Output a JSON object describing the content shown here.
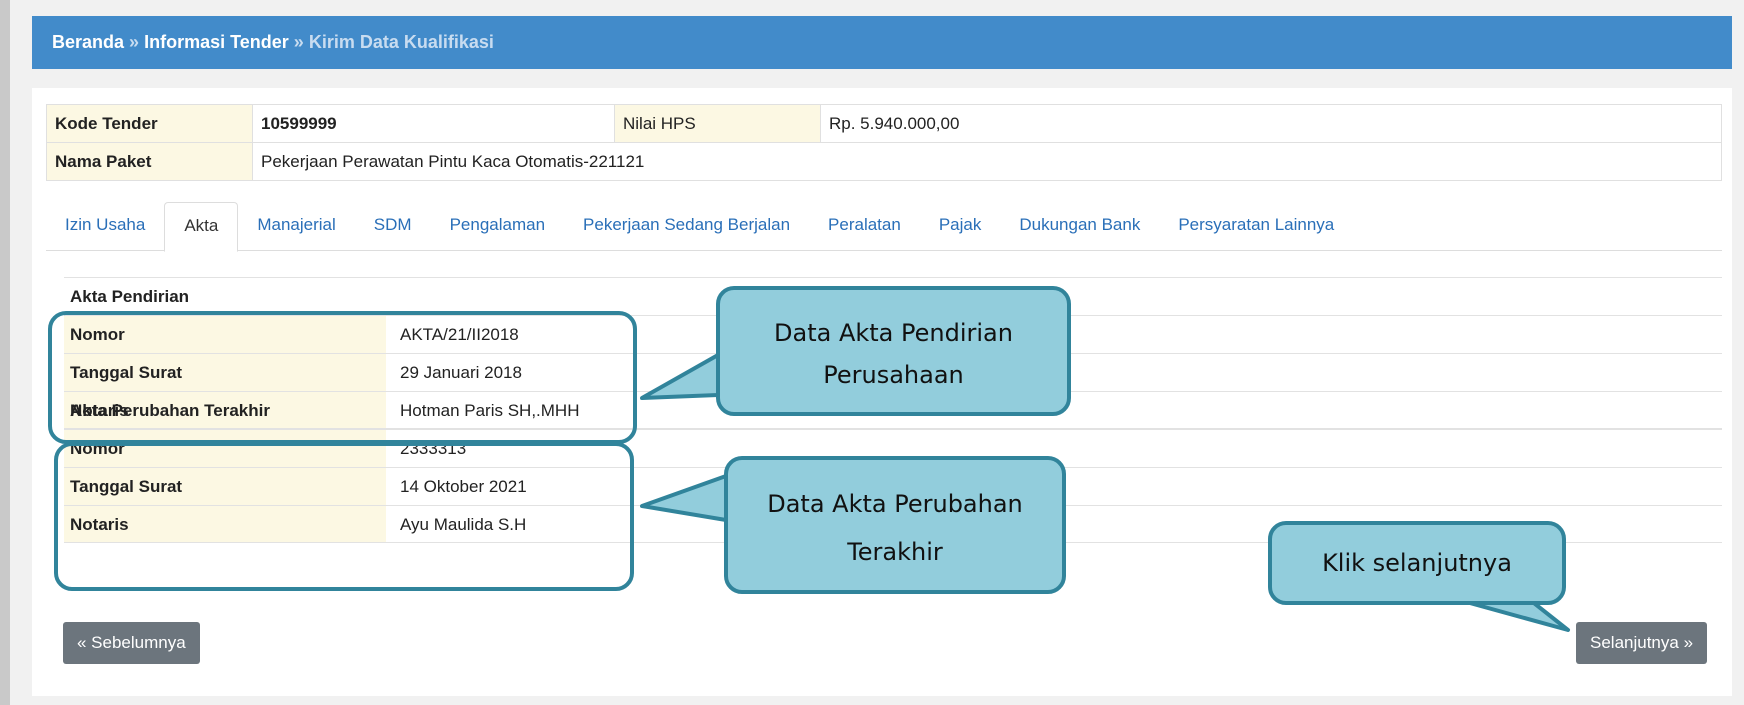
{
  "breadcrumb": {
    "home": "Beranda",
    "sep1": "»",
    "info": "Informasi Tender",
    "sep2": "»",
    "current": "Kirim Data Kualifikasi"
  },
  "tender": {
    "kode_label": "Kode Tender",
    "kode_value": "10599999",
    "hps_label": "Nilai HPS",
    "hps_value": "Rp. 5.940.000,00",
    "nama_label": "Nama Paket",
    "nama_value": "Pekerjaan Perawatan Pintu Kaca Otomatis-221121"
  },
  "tabs": [
    {
      "label": "Izin Usaha"
    },
    {
      "label": "Akta"
    },
    {
      "label": "Manajerial"
    },
    {
      "label": "SDM"
    },
    {
      "label": "Pengalaman"
    },
    {
      "label": "Pekerjaan Sedang Berjalan"
    },
    {
      "label": "Peralatan"
    },
    {
      "label": "Pajak"
    },
    {
      "label": "Dukungan Bank"
    },
    {
      "label": "Persyaratan Lainnya"
    }
  ],
  "akta_pendirian": {
    "title": "Akta Pendirian",
    "rows": [
      {
        "label": "Nomor",
        "value": "AKTA/21/II2018"
      },
      {
        "label": "Tanggal Surat",
        "value": "29 Januari 2018"
      },
      {
        "label": "Notaris",
        "value": "Hotman Paris SH,.MHH"
      }
    ]
  },
  "akta_perubahan": {
    "title": "Akta Perubahan Terakhir",
    "rows": [
      {
        "label": "Nomor",
        "value": "2333313"
      },
      {
        "label": "Tanggal Surat",
        "value": "14 Oktober 2021"
      },
      {
        "label": "Notaris",
        "value": "Ayu Maulida S.H"
      }
    ]
  },
  "buttons": {
    "prev": "« Sebelumnya",
    "next": "Selanjutnya »"
  },
  "callouts": {
    "pendirian_line1": "Data Akta Pendirian",
    "pendirian_line2": "Perusahaan",
    "perubahan_line1": "Data Akta Perubahan",
    "perubahan_line2": "Terakhir",
    "next": "Klik selanjutnya"
  },
  "colors": {
    "breadcrumb_bg": "#428bca",
    "label_bg": "#fcf8e3",
    "link": "#2a6fb8",
    "callout_fill": "#92cddc",
    "callout_border": "#31849b",
    "button_bg": "#6c757d"
  }
}
